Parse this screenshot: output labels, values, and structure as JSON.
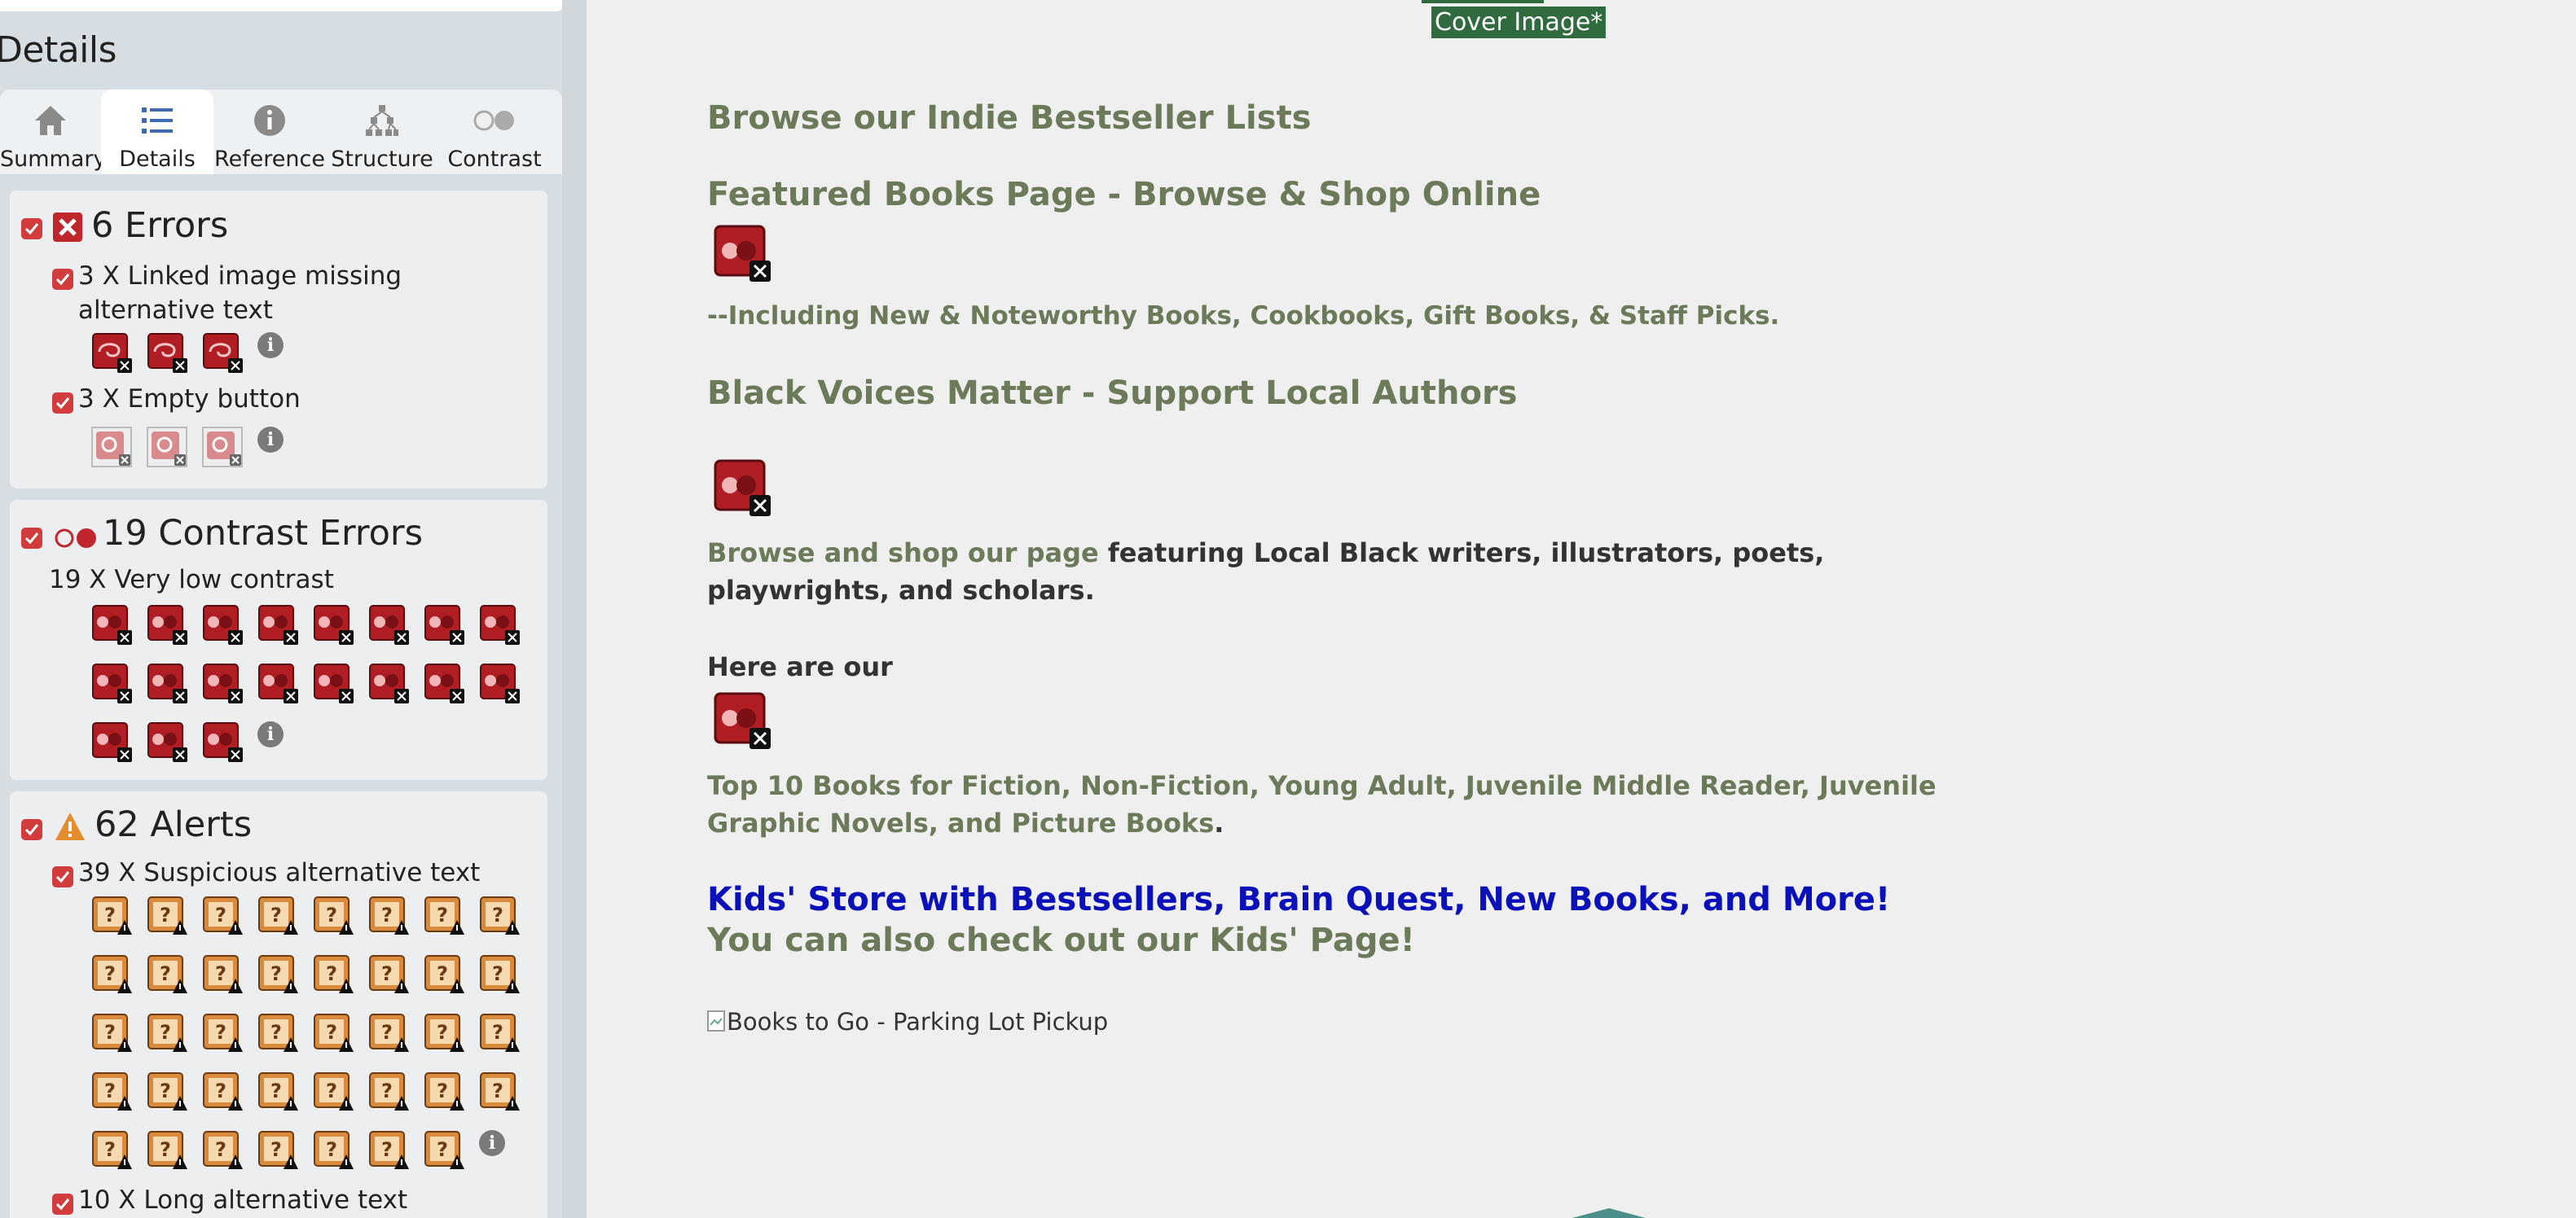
{
  "panel": {
    "title": "Details",
    "tabs": [
      {
        "label": "Summary",
        "icon": "home-icon"
      },
      {
        "label": "Details",
        "icon": "list-icon"
      },
      {
        "label": "Reference",
        "icon": "info-icon"
      },
      {
        "label": "Structure",
        "icon": "hierarchy-icon"
      },
      {
        "label": "Contrast",
        "icon": "contrast-icon"
      }
    ],
    "active_tab": "Details",
    "errors": {
      "heading": "6 Errors",
      "items": [
        {
          "text": "3 X Linked image missing alternative text",
          "count": 3
        },
        {
          "text": "3 X Empty button",
          "count": 3
        }
      ]
    },
    "contrast": {
      "heading": "19 Contrast Errors",
      "items": [
        {
          "text": "19 X Very low contrast",
          "count": 19
        }
      ]
    },
    "alerts": {
      "heading": "62 Alerts",
      "items": [
        {
          "text": "39 X Suspicious alternative text",
          "count": 39
        },
        {
          "text": "10 X Long alternative text",
          "count": 10
        }
      ]
    },
    "colors": {
      "error": "#c0272d",
      "alert": "#d98a3a",
      "check": "#d23c3c"
    }
  },
  "page": {
    "cover_badge": "Cover Image*",
    "browse_lists": "Browse our Indie Bestseller Lists",
    "featured": "Featured Books Page - Browse & Shop Online",
    "including": "--Including New & Noteworthy Books, Cookbooks, Gift Books, & Staff Picks.",
    "black_voices": "Black Voices Matter - Support Local Authors",
    "browse_shop_link": "Browse and shop our page",
    "browse_shop_rest": " featuring Local Black writers, illustrators, poets, playwrights, and scholars.",
    "here_are_our": "Here are our",
    "top10_link": "Top 10 Books for Fiction, Non-Fiction, Young Adult, Juvenile Middle Reader, Juvenile Graphic Novels, and Picture Books",
    "top10_end": ".",
    "kids_store": "Kids' Store with Bestsellers, Brain Quest, New Books, and More!",
    "kids_page": "You can also check out our Kids' Page!",
    "broken_image_alt": "Books to Go - Parking Lot Pickup",
    "colors": {
      "olive": "#6b7a58",
      "blue": "#0a11b8",
      "badge": "#2f6b3f"
    }
  }
}
